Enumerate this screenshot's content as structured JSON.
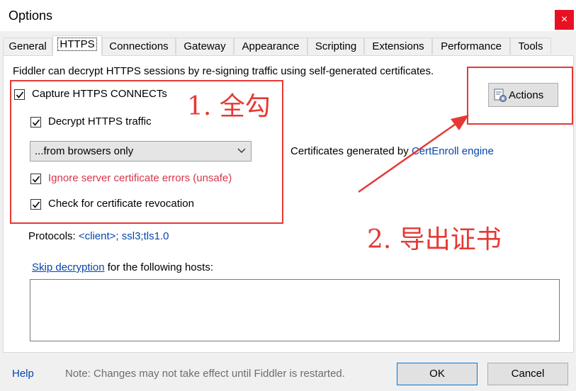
{
  "window": {
    "title": "Options",
    "close_glyph": "×"
  },
  "tabs": [
    "General",
    "HTTPS",
    "Connections",
    "Gateway",
    "Appearance",
    "Scripting",
    "Extensions",
    "Performance",
    "Tools"
  ],
  "active_tab": "HTTPS",
  "https": {
    "intro": "Fiddler can decrypt HTTPS sessions by re-signing traffic using self-generated certificates.",
    "capture_connects": {
      "label": "Capture HTTPS CONNECTs",
      "checked": true
    },
    "decrypt_traffic": {
      "label": "Decrypt HTTPS traffic",
      "checked": true
    },
    "decrypt_source": {
      "value": "...from browsers only"
    },
    "ignore_errors": {
      "label": "Ignore server certificate errors (unsafe)",
      "checked": true
    },
    "check_revocation": {
      "label": "Check for certificate revocation",
      "checked": true
    },
    "actions_label": "Actions",
    "cert_text": "Certificates generated by",
    "cert_engine_link": "CertEnroll engine",
    "protocols_label": "Protocols:",
    "protocols_value": "<client>; ssl3;tls1.0",
    "skip_link": "Skip decryption",
    "skip_text": "for the following hosts:",
    "skip_hosts_value": ""
  },
  "footer": {
    "help": "Help",
    "note": "Note: Changes may not take effect until Fiddler is restarted.",
    "ok": "OK",
    "cancel": "Cancel"
  },
  "annotations": {
    "step1": "1. 全勾",
    "step2": "2. 导出证书",
    "color": "#e53935"
  }
}
